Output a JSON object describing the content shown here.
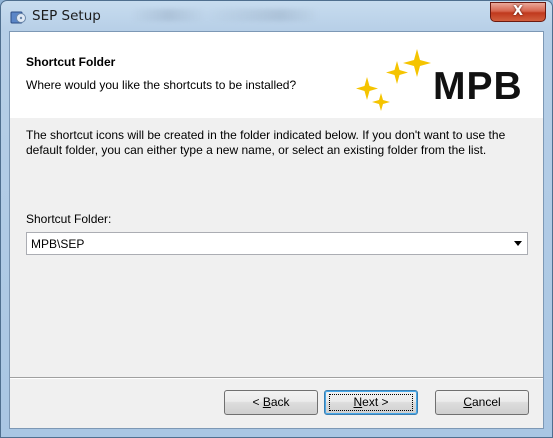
{
  "window": {
    "title": "SEP Setup",
    "close_glyph": "X",
    "app_icon": "setup-disk-icon"
  },
  "header": {
    "heading": "Shortcut Folder",
    "subheading": "Where would you like the shortcuts to be installed?",
    "logo_text": "MPB",
    "logo_color": "#f5c400"
  },
  "body": {
    "description": "The shortcut icons will be created in the folder indicated below. If you don't want to use the default folder, you can either type a new name, or select an existing folder from the list.",
    "field_label": "Shortcut Folder:",
    "field_value": "MPB\\SEP"
  },
  "buttons": {
    "back": {
      "prefix": "< ",
      "accel": "B",
      "rest": "ack"
    },
    "next": {
      "accel": "N",
      "rest": "ext >"
    },
    "cancel": {
      "accel": "C",
      "rest": "ancel"
    }
  }
}
